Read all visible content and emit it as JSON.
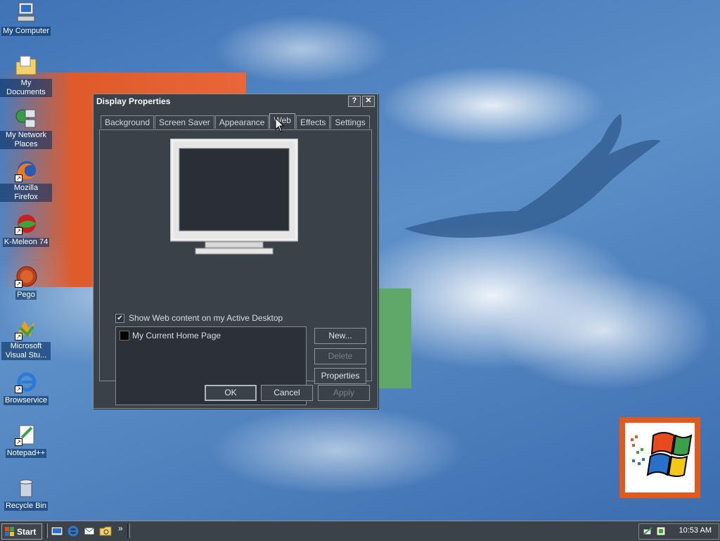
{
  "desktop": {
    "icons": [
      {
        "label": "My Computer",
        "icon": "computer-icon"
      },
      {
        "label": "My Documents",
        "icon": "folder-icon"
      },
      {
        "label": "My Network Places",
        "icon": "network-icon"
      },
      {
        "label": "Mozilla Firefox",
        "icon": "firefox-icon"
      },
      {
        "label": "K-Meleon 74",
        "icon": "kmeleon-icon"
      },
      {
        "label": "Pego",
        "icon": "pego-icon"
      },
      {
        "label": "Microsoft Visual Stu...",
        "icon": "visual-studio-icon"
      },
      {
        "label": "Browservice",
        "icon": "ie-icon"
      },
      {
        "label": "Notepad++",
        "icon": "notepad-icon"
      },
      {
        "label": "Recycle Bin",
        "icon": "recycle-bin-icon"
      }
    ]
  },
  "dialog": {
    "title": "Display Properties",
    "help_button": "?",
    "close_button": "✕",
    "tabs": [
      {
        "label": "Background"
      },
      {
        "label": "Screen Saver"
      },
      {
        "label": "Appearance"
      },
      {
        "label": "Web"
      },
      {
        "label": "Effects"
      },
      {
        "label": "Settings"
      }
    ],
    "active_tab": "Web",
    "web": {
      "checkbox_label": "Show Web content on my Active Desktop",
      "checkbox_checked": true,
      "list_items": [
        "My Current Home Page"
      ],
      "new_button": "New...",
      "delete_button": "Delete",
      "properties_button": "Properties"
    },
    "ok_button": "OK",
    "cancel_button": "Cancel",
    "apply_button": "Apply"
  },
  "taskbar": {
    "start_label": "Start",
    "chevron": "»",
    "clock": "10:53 AM"
  },
  "colors": {
    "desktop_blue": "#3f73b6",
    "dialog_bg": "#3b4149",
    "accent_orange": "#e05a1e"
  }
}
